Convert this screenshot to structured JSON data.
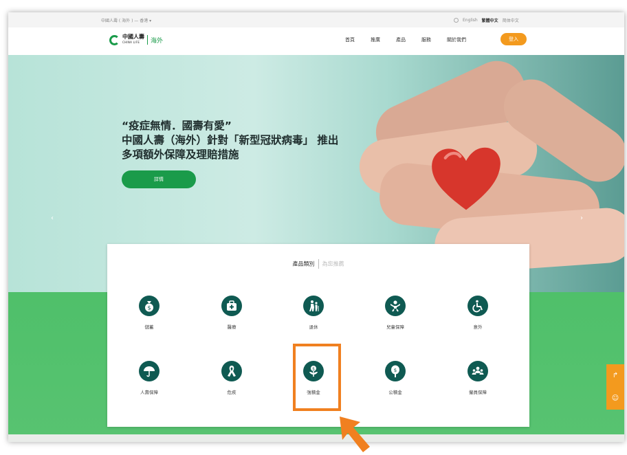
{
  "topbar": {
    "region": "中國人壽 ( 海外 ) — 香港 ▾",
    "lang_en": "English",
    "lang_tc": "繁體中文",
    "lang_sc": "简体中文"
  },
  "header": {
    "logo_cn": "中國人壽",
    "logo_en": "CHINA LIFE",
    "logo_sub": "海外",
    "nav": [
      "首頁",
      "推廣",
      "產品",
      "服務",
      "關於我們"
    ],
    "login": "登入"
  },
  "hero": {
    "line1": "“疫症無情．國壽有愛”",
    "line2": "中國人壽（海外）針對「新型冠狀病毒」 推出多項額外保障及理賠措施",
    "button": "詳情"
  },
  "card": {
    "tab_active": "產品類別",
    "tab_other": "為您推薦",
    "categories": [
      {
        "label": "儲蓄",
        "icon": "money-bag-icon"
      },
      {
        "label": "醫療",
        "icon": "medical-kit-icon"
      },
      {
        "label": "退休",
        "icon": "elderly-icon"
      },
      {
        "label": "兒童保障",
        "icon": "child-icon"
      },
      {
        "label": "意外",
        "icon": "wheelchair-icon"
      },
      {
        "label": "人壽保障",
        "icon": "umbrella-icon"
      },
      {
        "label": "危疾",
        "icon": "ribbon-icon"
      },
      {
        "label": "強積金",
        "icon": "money-plant-icon"
      },
      {
        "label": "公積金",
        "icon": "money-tree-icon"
      },
      {
        "label": "僱員保障",
        "icon": "employees-icon"
      }
    ]
  },
  "colors": {
    "brand_green": "#1a9b4a",
    "icon_dark": "#0f5a52",
    "accent_orange": "#f39a1e",
    "highlight": "#f08020"
  }
}
